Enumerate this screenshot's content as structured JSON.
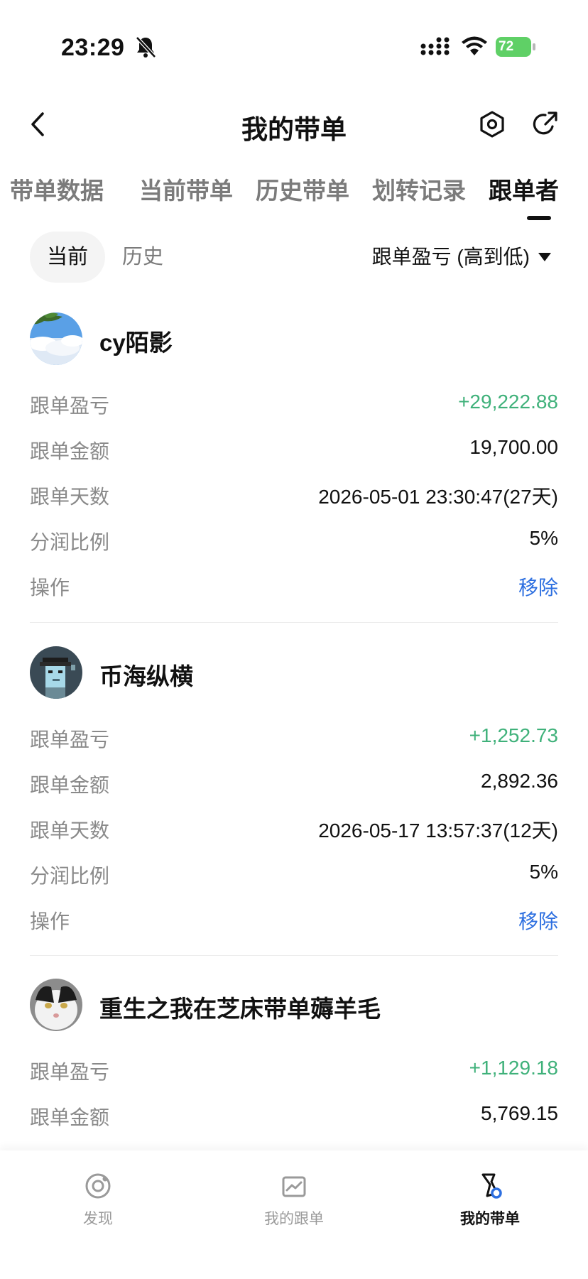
{
  "status_bar": {
    "time": "23:29",
    "battery": "72"
  },
  "header": {
    "title": "我的带单"
  },
  "tabs": [
    {
      "label": "带单数据"
    },
    {
      "label": "当前带单"
    },
    {
      "label": "历史带单"
    },
    {
      "label": "划转记录"
    },
    {
      "label": "跟单者"
    }
  ],
  "subtabs": {
    "current": "当前",
    "history": "历史"
  },
  "sort": {
    "label": "跟单盈亏 (高到低)"
  },
  "followers": [
    {
      "name": "cy陌影",
      "rows": [
        {
          "label": "跟单盈亏",
          "value": "+29,222.88"
        },
        {
          "label": "跟单金额",
          "value": "19,700.00"
        },
        {
          "label": "跟单天数",
          "value": "2026-05-01 23:30:47(27天)"
        },
        {
          "label": "分润比例",
          "value": "5%"
        },
        {
          "label": "操作",
          "value": "移除"
        }
      ]
    },
    {
      "name": "币海纵横",
      "rows": [
        {
          "label": "跟单盈亏",
          "value": "+1,252.73"
        },
        {
          "label": "跟单金额",
          "value": "2,892.36"
        },
        {
          "label": "跟单天数",
          "value": "2026-05-17 13:57:37(12天)"
        },
        {
          "label": "分润比例",
          "value": "5%"
        },
        {
          "label": "操作",
          "value": "移除"
        }
      ]
    },
    {
      "name": "重生之我在芝床带单薅羊毛",
      "rows": [
        {
          "label": "跟单盈亏",
          "value": "+1,129.18"
        },
        {
          "label": "跟单金额",
          "value": "5,769.15"
        }
      ]
    }
  ],
  "bottom_nav": [
    {
      "label": "发现",
      "icon": "discover-icon"
    },
    {
      "label": "我的跟单",
      "icon": "chart-icon"
    },
    {
      "label": "我的带单",
      "icon": "lead-trade-icon"
    }
  ],
  "colors": {
    "profit": "#3fb17a",
    "link": "#2d6fe0"
  }
}
